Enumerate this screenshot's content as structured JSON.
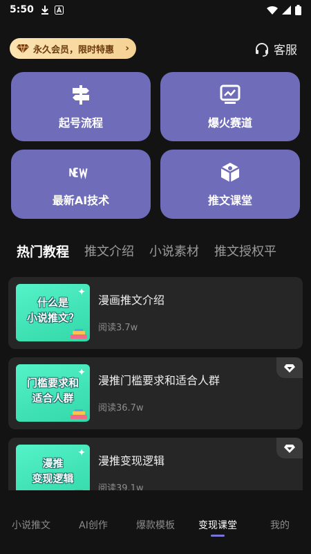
{
  "status_bar": {
    "time": "5:50"
  },
  "header": {
    "vip_label": "永久会员，限时特惠",
    "service_label": "客服"
  },
  "grid": [
    {
      "label": "起号流程",
      "icon": "signpost-icon"
    },
    {
      "label": "爆火赛道",
      "icon": "trend-chart-icon"
    },
    {
      "label": "最新AI技术",
      "icon": "new-badge-icon"
    },
    {
      "label": "推文课堂",
      "icon": "box-icon"
    }
  ],
  "tabs": [
    "热门教程",
    "推文介绍",
    "小说素材",
    "推文授权平"
  ],
  "tutorials": [
    {
      "thumb_text": "什么是\n小说推文？",
      "title": "漫画推文介绍",
      "reads": "阅读3.7w",
      "vip": false
    },
    {
      "thumb_text": "门槛要求和\n适合人群",
      "title": "漫推门槛要求和适合人群",
      "reads": "阅读36.7w",
      "vip": true
    },
    {
      "thumb_text": "漫推\n变现逻辑",
      "title": "漫推变现逻辑",
      "reads": "阅读39.1w",
      "vip": true
    }
  ],
  "bottom_nav": [
    "小说推文",
    "AI创作",
    "爆款模板",
    "变现课堂",
    "我的"
  ],
  "colors": {
    "card_bg": "#6f6cb9",
    "accent": "#7b76d6",
    "vip_gold": "#f5d294",
    "thumb_green": "#54f2c8"
  }
}
